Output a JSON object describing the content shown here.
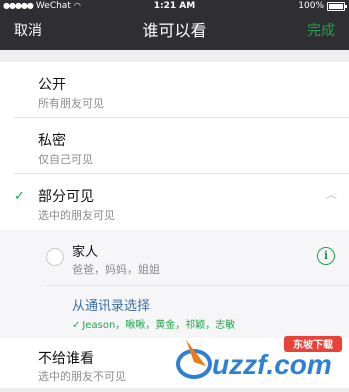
{
  "status_bar": {
    "carrier": "WeChat",
    "time": "1:21 AM",
    "battery": "100%"
  },
  "nav": {
    "cancel": "取消",
    "title": "谁可以看",
    "done": "完成"
  },
  "options": [
    {
      "title": "公开",
      "subtitle": "所有朋友可见",
      "selected": false
    },
    {
      "title": "私密",
      "subtitle": "仅自己可见",
      "selected": false
    },
    {
      "title": "部分可见",
      "subtitle": "选中的朋友可见",
      "selected": true,
      "expanded": true
    },
    {
      "title": "不给谁看",
      "subtitle": "选中的朋友不可见",
      "selected": false
    }
  ],
  "groups": [
    {
      "name": "家人",
      "members": "爸爸，妈妈，姐姐"
    }
  ],
  "contacts": {
    "link": "从通讯录选择",
    "selected": "Jeason，啾啾，黄金，祁颖，志敏"
  },
  "icons": {
    "check": "checkmark-icon",
    "chevron": "chevron-up-icon",
    "info": "info-icon",
    "radio": "radio-empty-icon",
    "wifi": "wifi-icon",
    "battery": "battery-icon"
  },
  "colors": {
    "nav_background": "#2e2e33",
    "accent_green": "#20a34a",
    "link_blue": "#3a6fa8",
    "page_background": "#eeeef0"
  }
}
